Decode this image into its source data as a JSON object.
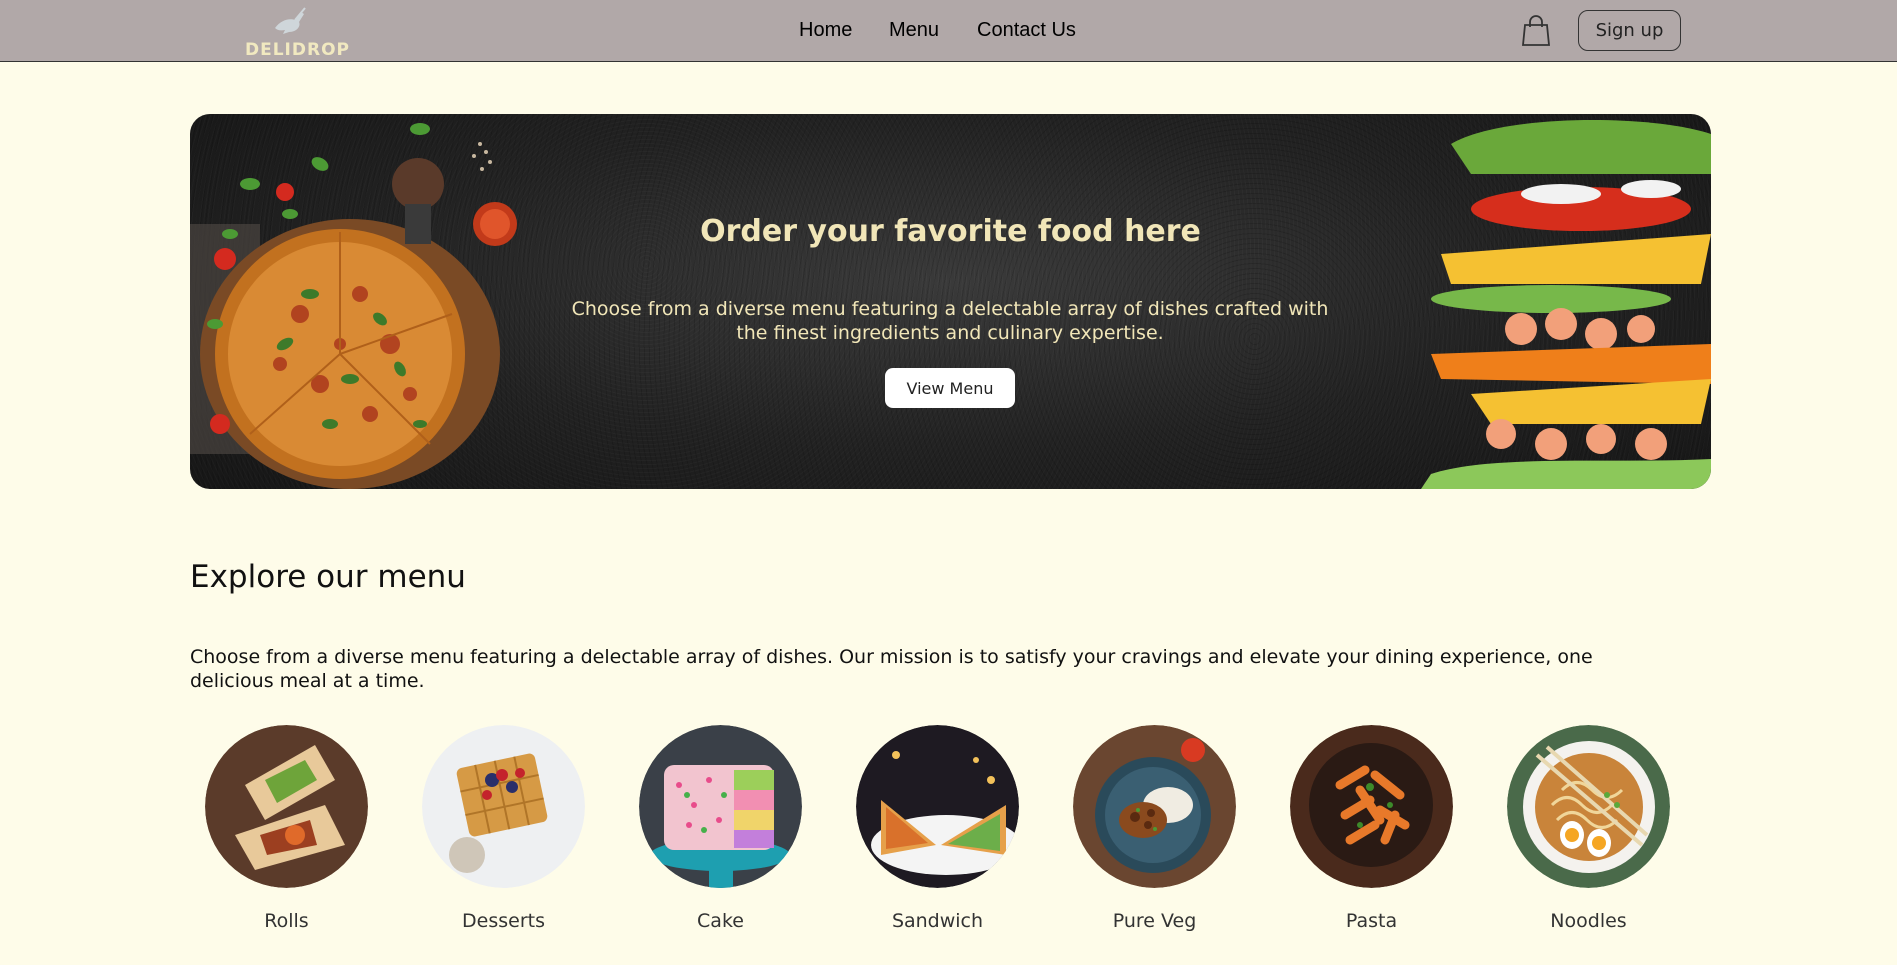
{
  "brand": {
    "name": "DELIDROP"
  },
  "nav": {
    "links": [
      {
        "label": "Home"
      },
      {
        "label": "Menu"
      },
      {
        "label": "Contact Us"
      }
    ],
    "cart_icon": "shopping-bag-icon",
    "signup_label": "Sign up"
  },
  "hero": {
    "title": "Order your favorite food here",
    "description": "Choose from a diverse menu featuring a delectable array of dishes crafted with the finest ingredients and culinary expertise.",
    "button_label": "View Menu"
  },
  "explore": {
    "title": "Explore our menu",
    "description": "Choose from a diverse menu featuring a delectable array of dishes. Our mission is to satisfy your cravings and elevate your dining experience, one delicious meal at a time.",
    "items": [
      {
        "label": "Rolls"
      },
      {
        "label": "Desserts"
      },
      {
        "label": "Cake"
      },
      {
        "label": "Sandwich"
      },
      {
        "label": "Pure Veg"
      },
      {
        "label": "Pasta"
      },
      {
        "label": "Noodles"
      }
    ]
  },
  "colors": {
    "page_bg": "#fefce9",
    "navbar_bg": "#b1a8a8",
    "hero_text": "#f1e6b8"
  }
}
